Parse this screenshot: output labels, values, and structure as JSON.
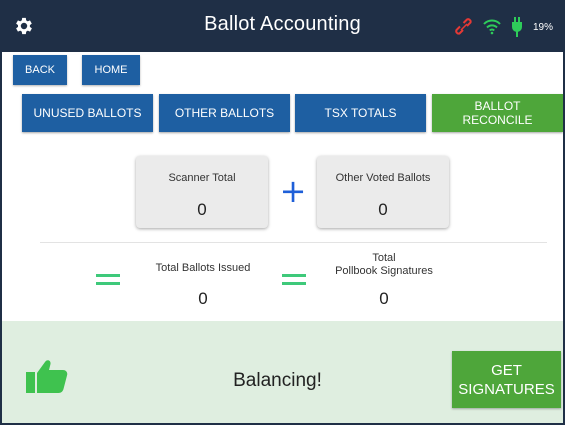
{
  "header": {
    "title": "Ballot Accounting",
    "battery_text": "19%",
    "icons": [
      "gear-icon",
      "link-broken-icon",
      "wifi-icon",
      "power-plug-icon"
    ]
  },
  "nav": {
    "back_label": "BACK",
    "home_label": "HOME"
  },
  "tabs": [
    {
      "label": "UNUSED BALLOTS",
      "active": false
    },
    {
      "label": "OTHER BALLOTS",
      "active": false
    },
    {
      "label": "TSX TOTALS",
      "active": false
    },
    {
      "label": "BALLOT RECONCILE",
      "active": true
    }
  ],
  "cards": [
    {
      "label": "Scanner Total",
      "value": "0"
    },
    {
      "label": "Other Voted Ballots",
      "value": "0"
    }
  ],
  "operator_plus": "+",
  "summary": [
    {
      "label": "Total Ballots Issued",
      "value": "0"
    },
    {
      "label_line1": "Total",
      "label_line2": "Pollbook Signatures",
      "value": "0"
    }
  ],
  "bottom": {
    "status_text": "Balancing!",
    "button_line1": "GET",
    "button_line2": "SIGNATURES",
    "icon": "thumbs-up-icon"
  },
  "colors": {
    "header_bg": "#1f2f46",
    "button_blue": "#1e5fa2",
    "button_green": "#4ea63a",
    "equals_green": "#3ec97a",
    "plus_blue": "#1e5fd8",
    "panel_bg": "#dfeee0",
    "broken_link_red": "#e53935",
    "wifi_green": "#2ecc5a"
  }
}
